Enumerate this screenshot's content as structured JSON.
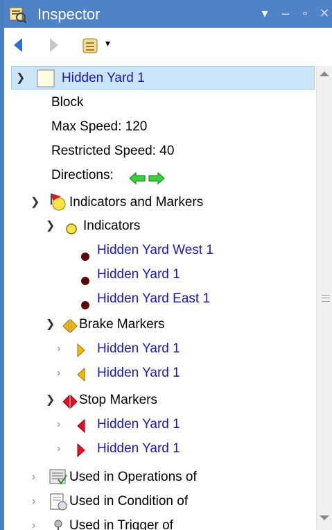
{
  "window": {
    "title": "Inspector",
    "controls": {
      "menu": "▾",
      "minimize": "–",
      "restore": "▫",
      "close": "✕"
    }
  },
  "toolbar": {
    "back_icon": "back-arrow-icon",
    "forward_icon": "forward-arrow-icon",
    "history_icon": "scroll-history-icon",
    "dropdown": "▾"
  },
  "tree": {
    "root": "Hidden Yard 1",
    "details": {
      "block": "Block",
      "max_speed": "Max Speed: 120",
      "restricted_speed": "Restricted Speed: 40",
      "directions": "Directions:"
    },
    "indicators_and_markers": "Indicators and Markers",
    "indicators": {
      "label": "Indicators",
      "items": [
        "Hidden Yard West 1",
        "Hidden Yard 1",
        "Hidden Yard East 1"
      ]
    },
    "brake_markers": {
      "label": "Brake Markers",
      "items": [
        "Hidden Yard 1",
        "Hidden Yard 1"
      ]
    },
    "stop_markers": {
      "label": "Stop Markers",
      "items": [
        "Hidden Yard 1",
        "Hidden Yard 1"
      ]
    },
    "used_in_operations": "Used in Operations of",
    "used_in_condition": "Used in Condition of",
    "used_in_trigger": "Used in Trigger of"
  },
  "colors": {
    "titlebar": "#4f82c6",
    "selection": "#cce4f7",
    "link": "#1a1ab0",
    "indicator_dot": "#5a0a0a",
    "brake_marker": "#f5b800",
    "stop_marker": "#e0102a",
    "direction_arrow": "#2ec02e"
  }
}
